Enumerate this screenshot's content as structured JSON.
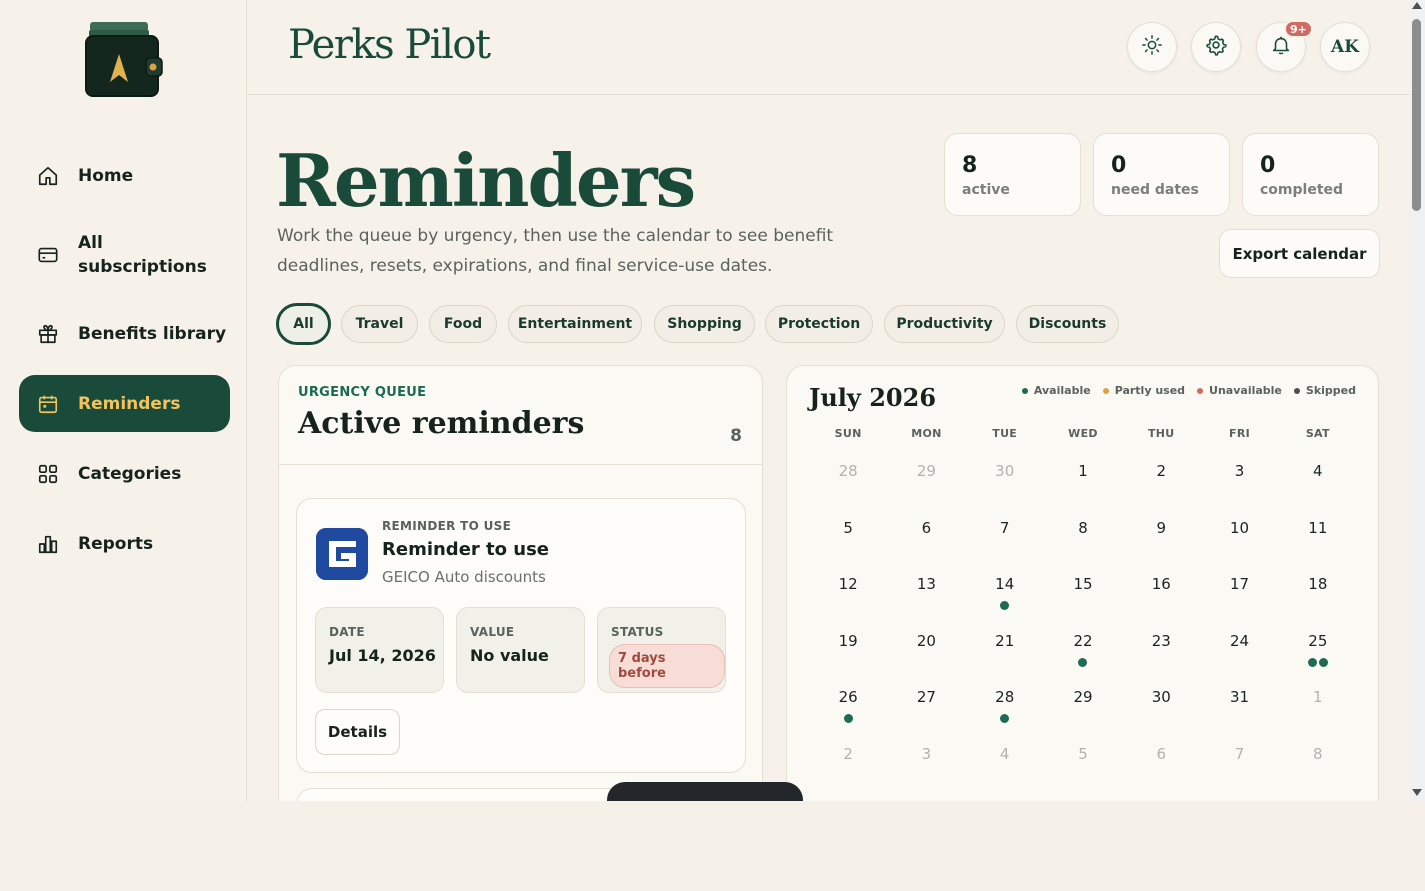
{
  "app": {
    "brand": "Perks Pilot"
  },
  "sidebar": {
    "items": [
      {
        "label": "Home",
        "icon": "home-icon"
      },
      {
        "label": "All subscriptions",
        "icon": "card-icon"
      },
      {
        "label": "Benefits library",
        "icon": "gift-icon"
      },
      {
        "label": "Reminders",
        "icon": "calendar-icon",
        "active": true
      },
      {
        "label": "Categories",
        "icon": "grid-icon"
      },
      {
        "label": "Reports",
        "icon": "bar-chart-icon"
      }
    ]
  },
  "header": {
    "notification_badge": "9+",
    "avatar_initials": "AK"
  },
  "page": {
    "title": "Reminders",
    "description": "Work the queue by urgency, then use the calendar to see benefit deadlines, resets, expirations, and final service-use dates.",
    "stats": [
      {
        "value": "8",
        "label": "active"
      },
      {
        "value": "0",
        "label": "need dates"
      },
      {
        "value": "0",
        "label": "completed"
      }
    ],
    "export_label": "Export calendar"
  },
  "filters": [
    "All",
    "Travel",
    "Food",
    "Entertainment",
    "Shopping",
    "Protection",
    "Productivity",
    "Discounts"
  ],
  "queue": {
    "eyebrow": "URGENCY QUEUE",
    "title": "Active reminders",
    "count": "8",
    "card": {
      "eyebrow": "REMINDER TO USE",
      "title": "Reminder to use",
      "subtitle": "GEICO Auto discounts",
      "date_label": "DATE",
      "date_value": "Jul 14, 2026",
      "value_label": "VALUE",
      "value_value": "No value",
      "status_label": "STATUS",
      "status_value": "7 days before",
      "details_label": "Details"
    }
  },
  "calendar": {
    "title": "July 2026",
    "legend": [
      {
        "label": "Available",
        "color": "#1f6a52"
      },
      {
        "label": "Partly used",
        "color": "#d9a441"
      },
      {
        "label": "Unavailable",
        "color": "#d4695f"
      },
      {
        "label": "Skipped",
        "color": "#4a4f4b"
      }
    ],
    "days_of_week": [
      "SUN",
      "MON",
      "TUE",
      "WED",
      "THU",
      "FRI",
      "SAT"
    ],
    "weeks": [
      [
        {
          "d": "28",
          "m": true
        },
        {
          "d": "29",
          "m": true
        },
        {
          "d": "30",
          "m": true
        },
        {
          "d": "1"
        },
        {
          "d": "2"
        },
        {
          "d": "3"
        },
        {
          "d": "4"
        }
      ],
      [
        {
          "d": "5"
        },
        {
          "d": "6"
        },
        {
          "d": "7"
        },
        {
          "d": "8"
        },
        {
          "d": "9"
        },
        {
          "d": "10"
        },
        {
          "d": "11"
        }
      ],
      [
        {
          "d": "12"
        },
        {
          "d": "13"
        },
        {
          "d": "14",
          "dots": 1
        },
        {
          "d": "15"
        },
        {
          "d": "16"
        },
        {
          "d": "17"
        },
        {
          "d": "18"
        }
      ],
      [
        {
          "d": "19"
        },
        {
          "d": "20"
        },
        {
          "d": "21"
        },
        {
          "d": "22",
          "dots": 1
        },
        {
          "d": "23"
        },
        {
          "d": "24"
        },
        {
          "d": "25",
          "dots": 2
        }
      ],
      [
        {
          "d": "26",
          "dots": 1
        },
        {
          "d": "27"
        },
        {
          "d": "28",
          "dots": 1
        },
        {
          "d": "29"
        },
        {
          "d": "30"
        },
        {
          "d": "31"
        },
        {
          "d": "1",
          "m": true
        }
      ],
      [
        {
          "d": "2",
          "m": true
        },
        {
          "d": "3",
          "m": true
        },
        {
          "d": "4",
          "m": true
        },
        {
          "d": "5",
          "m": true
        },
        {
          "d": "6",
          "m": true
        },
        {
          "d": "7",
          "m": true
        },
        {
          "d": "8",
          "m": true
        }
      ]
    ]
  }
}
